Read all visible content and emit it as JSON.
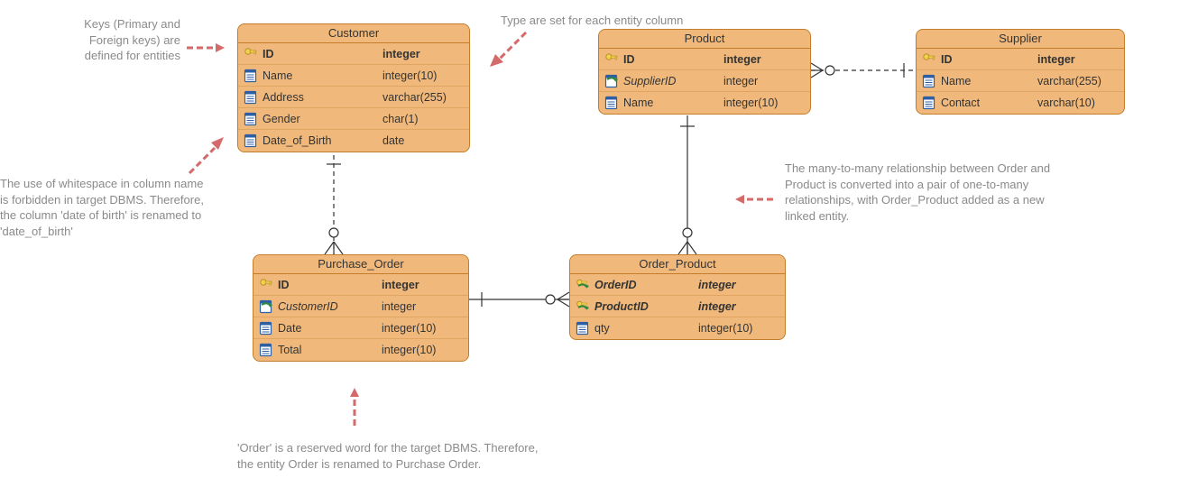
{
  "entities": {
    "customer": {
      "title": "Customer",
      "rows": [
        {
          "icon": "pk",
          "name": "ID",
          "type": "integer"
        },
        {
          "icon": "col",
          "name": "Name",
          "type": "integer(10)"
        },
        {
          "icon": "col",
          "name": "Address",
          "type": "varchar(255)"
        },
        {
          "icon": "col",
          "name": "Gender",
          "type": "char(1)"
        },
        {
          "icon": "col",
          "name": "Date_of_Birth",
          "type": "date"
        }
      ]
    },
    "product": {
      "title": "Product",
      "rows": [
        {
          "icon": "pk",
          "name": "ID",
          "type": "integer"
        },
        {
          "icon": "fk",
          "name": "SupplierID",
          "type": "integer"
        },
        {
          "icon": "col",
          "name": "Name",
          "type": "integer(10)"
        }
      ]
    },
    "supplier": {
      "title": "Supplier",
      "rows": [
        {
          "icon": "pk",
          "name": "ID",
          "type": "integer"
        },
        {
          "icon": "col",
          "name": "Name",
          "type": "varchar(255)"
        },
        {
          "icon": "col",
          "name": "Contact",
          "type": "varchar(10)"
        }
      ]
    },
    "purchase_order": {
      "title": "Purchase_Order",
      "rows": [
        {
          "icon": "pk",
          "name": "ID",
          "type": "integer"
        },
        {
          "icon": "fk",
          "name": "CustomerID",
          "type": "integer"
        },
        {
          "icon": "col",
          "name": "Date",
          "type": "integer(10)"
        },
        {
          "icon": "col",
          "name": "Total",
          "type": "integer(10)"
        }
      ]
    },
    "order_product": {
      "title": "Order_Product",
      "rows": [
        {
          "icon": "pkfk",
          "name": "OrderID",
          "type": "integer"
        },
        {
          "icon": "pkfk",
          "name": "ProductID",
          "type": "integer"
        },
        {
          "icon": "col",
          "name": "qty",
          "type": "integer(10)"
        }
      ]
    }
  },
  "annotations": {
    "keys": "Keys (Primary and\nForeign keys) are\ndefined for entities",
    "types": "Type are set for each entity column",
    "ws": "The use of whitespace in column name\nis forbidden in target DBMS. Therefore,\nthe column 'date of birth' is renamed to\n'date_of_birth'",
    "m2m": "The many-to-many relationship between Order and\nProduct is converted into a pair of one-to-many\nrelationships, with Order_Product added as a new\nlinked entity.",
    "order": "'Order' is a reserved word for the target DBMS. Therefore,\nthe entity Order is renamed to Purchase Order."
  }
}
